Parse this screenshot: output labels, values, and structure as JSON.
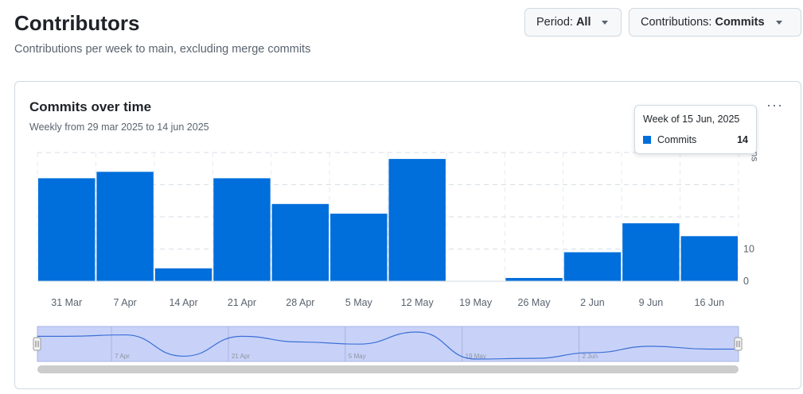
{
  "header": {
    "title": "Contributors",
    "subtitle": "Contributions per week to main, excluding merge commits"
  },
  "filters": {
    "period_label": "Period:",
    "period_value": "All",
    "contrib_label": "Contributions:",
    "contrib_value": "Commits"
  },
  "card": {
    "title": "Commits over time",
    "subtitle": "Weekly from 29 mar 2025 to 14 jun 2025",
    "menu_icon": "kebab-horizontal-icon"
  },
  "tooltip": {
    "title": "Week of 15 Jun, 2025",
    "series": "Commits",
    "value": "14"
  },
  "y_axis_partial": "ns",
  "colors": {
    "bar": "#006edb",
    "navigator_fill": "#c8d2f8",
    "navigator_line": "#3c6fd6",
    "scrollbar": "#cccccc"
  },
  "chart_data": {
    "type": "bar",
    "series": [
      {
        "name": "Commits",
        "values": [
          32,
          34,
          4,
          32,
          24,
          21,
          38,
          0,
          1,
          9,
          18,
          14
        ]
      }
    ],
    "categories": [
      "31 Mar",
      "7 Apr",
      "14 Apr",
      "21 Apr",
      "28 Apr",
      "5 May",
      "12 May",
      "19 May",
      "26 May",
      "2 Jun",
      "9 Jun",
      "16 Jun"
    ],
    "y_ticks_visible": [
      "10",
      "0"
    ],
    "ylim": [
      0,
      40
    ],
    "grid": true,
    "navigator_labels": [
      "7 Apr",
      "21 Apr",
      "5 May",
      "19 May",
      "2 Jun"
    ]
  }
}
